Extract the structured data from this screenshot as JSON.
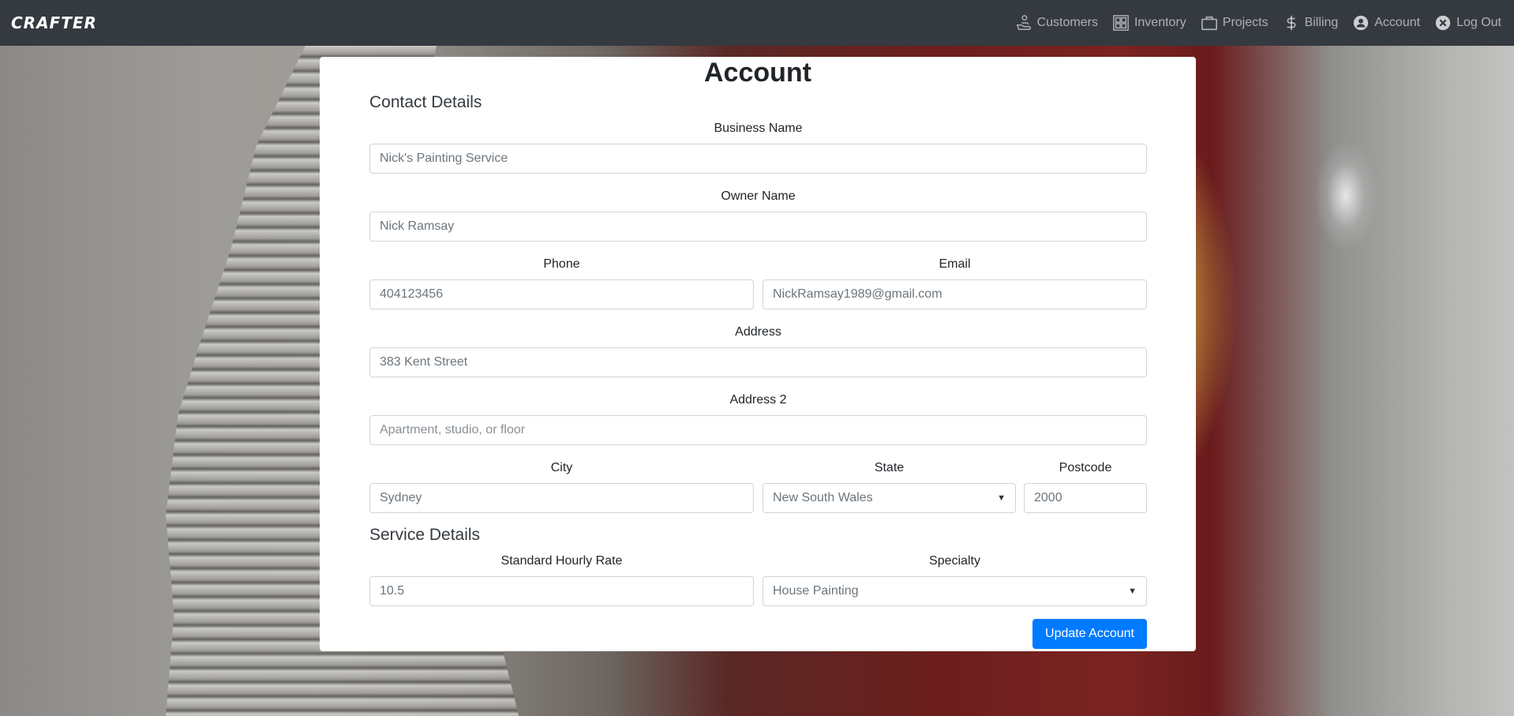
{
  "nav": {
    "brand": "CRAFTER",
    "items": [
      {
        "label": "Customers",
        "icon": "customer-icon"
      },
      {
        "label": "Inventory",
        "icon": "inventory-icon"
      },
      {
        "label": "Projects",
        "icon": "briefcase-icon"
      },
      {
        "label": "Billing",
        "icon": "dollar-icon"
      },
      {
        "label": "Account",
        "icon": "user-circle-icon"
      },
      {
        "label": "Log Out",
        "icon": "close-circle-icon"
      }
    ]
  },
  "page": {
    "title": "Account",
    "contact_section": "Contact Details",
    "service_section": "Service Details"
  },
  "form": {
    "business_name": {
      "label": "Business Name",
      "value": "Nick's Painting Service"
    },
    "owner_name": {
      "label": "Owner Name",
      "value": "Nick Ramsay"
    },
    "phone": {
      "label": "Phone",
      "value": "404123456"
    },
    "email": {
      "label": "Email",
      "value": "NickRamsay1989@gmail.com"
    },
    "address": {
      "label": "Address",
      "value": "383 Kent Street"
    },
    "address2": {
      "label": "Address 2",
      "placeholder": "Apartment, studio, or floor"
    },
    "city": {
      "label": "City",
      "value": "Sydney"
    },
    "state": {
      "label": "State",
      "value": "New South Wales"
    },
    "postcode": {
      "label": "Postcode",
      "value": "2000"
    },
    "hourly_rate": {
      "label": "Standard Hourly Rate",
      "value": "10.5"
    },
    "specialty": {
      "label": "Specialty",
      "value": "House Painting"
    },
    "submit_label": "Update Account"
  },
  "colors": {
    "navbar": "#343a40",
    "primary": "#007bff"
  }
}
